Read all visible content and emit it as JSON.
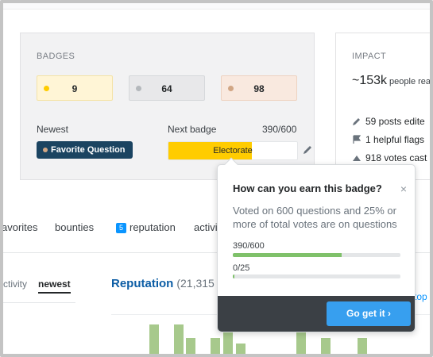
{
  "badges": {
    "heading": "BADGES",
    "gold": "9",
    "silver": "64",
    "bronze": "98",
    "newest_label": "Newest",
    "newest_badge": "Favorite Question",
    "next_label": "Next badge",
    "next_progress_text": "390/600",
    "next_badge_name": "Electorate",
    "next_progress": 0.65
  },
  "impact": {
    "heading": "IMPACT",
    "value": "~153k",
    "value_sub": "people rea",
    "rows": [
      "59 posts edite",
      "1 helpful flags",
      "918 votes cast"
    ]
  },
  "tabs": [
    "avorites",
    "bounties",
    "reputation",
    "activi"
  ],
  "rep_badge_count": "5",
  "subtabs": [
    "ctivity",
    "newest"
  ],
  "reputation": {
    "title": "Reputation",
    "count": "(21,315"
  },
  "top_link": "top",
  "popover": {
    "title": "How can you earn this badge?",
    "close": "×",
    "description": "Voted on 600 questions and 25% or more of total votes are on questions",
    "progress1_label": "390/600",
    "progress1": 0.65,
    "progress2_label": "0/25",
    "progress2": 0,
    "button": "Go get it ›"
  },
  "colors": {
    "gold": "#ffcc00",
    "link": "#0c5da5",
    "button": "#379fef",
    "progress": "#7fc16a"
  }
}
